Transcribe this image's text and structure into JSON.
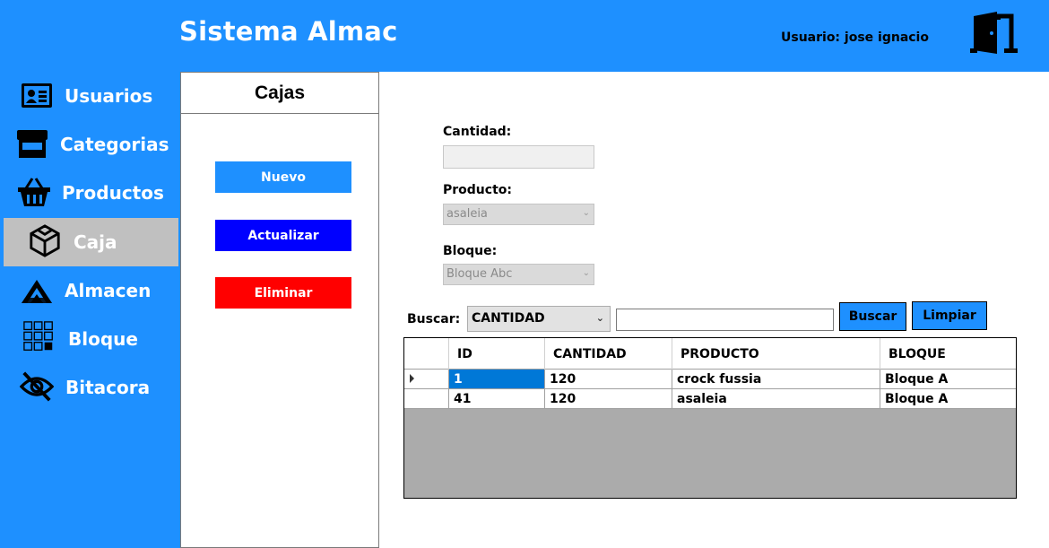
{
  "header": {
    "title": "Sistema Almac",
    "user_label": "Usuario: jose ignacio"
  },
  "sidebar": {
    "items": [
      {
        "label": "Usuarios",
        "icon": "user-card-icon",
        "active": false
      },
      {
        "label": "Categorias",
        "icon": "store-icon",
        "active": false
      },
      {
        "label": "Productos",
        "icon": "basket-icon",
        "active": false
      },
      {
        "label": "Caja",
        "icon": "cube-icon",
        "active": true
      },
      {
        "label": "Almacen",
        "icon": "warehouse-icon",
        "active": false
      },
      {
        "label": "Bloque",
        "icon": "grid-blocks-icon",
        "active": false
      },
      {
        "label": "Bitacora",
        "icon": "eye-off-icon",
        "active": false
      }
    ]
  },
  "panel": {
    "title": "Cajas",
    "buttons": {
      "nuevo": "Nuevo",
      "actualizar": "Actualizar",
      "eliminar": "Eliminar"
    }
  },
  "form": {
    "cantidad_label": "Cantidad:",
    "cantidad_value": "",
    "producto_label": "Producto:",
    "producto_value": "asaleia",
    "bloque_label": "Bloque:",
    "bloque_value": "Bloque Abc"
  },
  "search": {
    "label": "Buscar:",
    "field_value": "CANTIDAD",
    "query": "",
    "buscar_button": "Buscar",
    "limpiar_button": "Limpiar"
  },
  "grid": {
    "columns": [
      "ID",
      "CANTIDAD",
      "PRODUCTO",
      "BLOQUE"
    ],
    "rows": [
      [
        "1",
        "120",
        "crock fussia",
        "Bloque A"
      ],
      [
        "41",
        "120",
        "asaleia",
        "Bloque A"
      ]
    ]
  },
  "colors": {
    "primary_blue": "#1e90ff",
    "nuevo_button": "#1e90ff",
    "actualizar_button": "#0000ff",
    "eliminar_button": "#ff0000",
    "active_nav": "#c0c0c0",
    "grid_empty": "#ababab",
    "selection": "#0078d7"
  }
}
